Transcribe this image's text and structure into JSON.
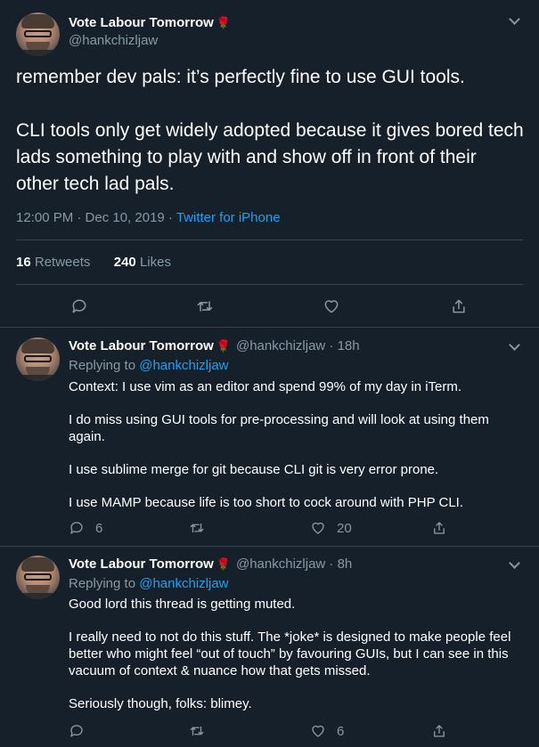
{
  "main": {
    "name": "Vote Labour Tomorrow",
    "rose": "🌹",
    "handle": "@hankchizljaw",
    "text_p1": "remember dev pals: it’s perfectly fine to use GUI tools.",
    "text_p2": "CLI tools only get widely adopted because it gives bored tech lads something to play with and show off in front of their other tech lad pals.",
    "time": "12:00 PM · Dec 10, 2019 · ",
    "source": "Twitter for iPhone",
    "retweets_count": "16",
    "retweets_label": "Retweets",
    "likes_count": "240",
    "likes_label": "Likes"
  },
  "replies": [
    {
      "name": "Vote Labour Tomorrow",
      "rose": "🌹",
      "handle_time": "@hankchizljaw · 18h",
      "replying_label": "Replying to ",
      "replying_to": "@hankchizljaw",
      "paragraphs": [
        "Context: I use vim as an editor and spend 99% of my day in iTerm.",
        "I do miss using GUI tools for pre-processing and will look at using them again.",
        "I use sublime merge for git because CLI git is very error prone.",
        "I use MAMP because life is too short to cock around with PHP CLI."
      ],
      "reply_count": "6",
      "retweet_count": "",
      "like_count": "20"
    },
    {
      "name": "Vote Labour Tomorrow",
      "rose": "🌹",
      "handle_time": "@hankchizljaw · 8h",
      "replying_label": "Replying to ",
      "replying_to": "@hankchizljaw",
      "paragraphs": [
        "Good lord this thread is getting muted.",
        "I really need to not do this stuff. The *joke* is designed to make people feel better who might feel “out of touch” by favouring GUIs, but I can see in this vacuum of context & nuance how that gets missed.",
        "Seriously though, folks: blimey."
      ],
      "reply_count": "",
      "retweet_count": "",
      "like_count": "6"
    }
  ],
  "icons": {
    "reply": "reply-icon",
    "retweet": "retweet-icon",
    "like": "heart-icon",
    "share": "share-icon",
    "more": "chevron-down-icon"
  },
  "colors": {
    "background": "#15202b",
    "border": "#38444d",
    "secondary_text": "#8899a6",
    "link": "#1da1f2",
    "rose": "#e0245e"
  }
}
